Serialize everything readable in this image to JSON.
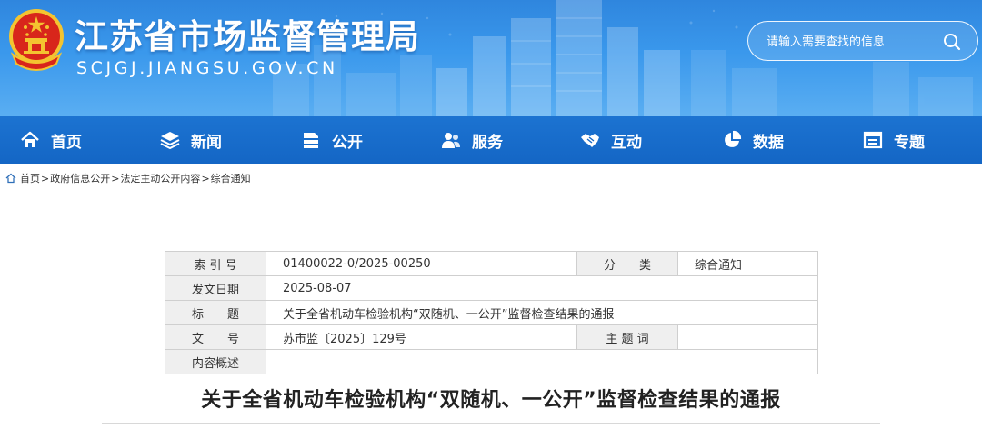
{
  "header": {
    "title": "江苏省市场监督管理局",
    "url": "SCJGJ.JIANGSU.GOV.CN",
    "search_placeholder": "请输入需要查找的信息"
  },
  "nav": {
    "items": [
      {
        "label": "首页",
        "icon": "home-icon"
      },
      {
        "label": "新闻",
        "icon": "layers-icon"
      },
      {
        "label": "公开",
        "icon": "stack-icon"
      },
      {
        "label": "服务",
        "icon": "users-icon"
      },
      {
        "label": "互动",
        "icon": "handshake-icon"
      },
      {
        "label": "数据",
        "icon": "pie-chart-icon"
      },
      {
        "label": "专题",
        "icon": "window-icon"
      }
    ]
  },
  "breadcrumb": {
    "items": [
      "首页",
      "政府信息公开",
      "法定主动公开内容",
      "综合通知"
    ],
    "separator": ">"
  },
  "meta": {
    "index_label": "索 引 号",
    "index_value": "01400022-0/2025-00250",
    "category_label": "分　　类",
    "category_value": "综合通知",
    "date_label": "发文日期",
    "date_value": "2025-08-07",
    "title_label": "标　　题",
    "title_value": "关于全省机动车检验机构“双随机、一公开”监督检查结果的通报",
    "docno_label": "文　　号",
    "docno_value": "苏市监〔2025〕129号",
    "keywords_label": "主 题 词",
    "keywords_value": "",
    "summary_label": "内容概述",
    "summary_value": ""
  },
  "article": {
    "title": "关于全省机动车检验机构“双随机、一公开”监督检查结果的通报"
  },
  "colors": {
    "header_blue": "#2f86de",
    "nav_blue": "#1466c5",
    "emblem_red": "#d8261b",
    "emblem_gold": "#f4c430"
  }
}
